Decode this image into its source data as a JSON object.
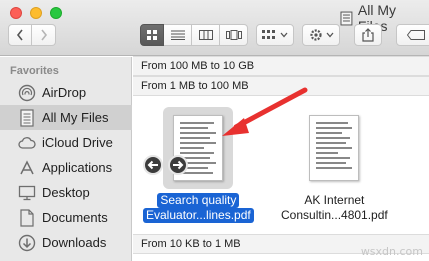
{
  "window": {
    "title": "All My Files"
  },
  "sidebar": {
    "header": "Favorites",
    "items": [
      {
        "label": "AirDrop",
        "icon": "airdrop-icon"
      },
      {
        "label": "All My Files",
        "icon": "all-my-files-icon",
        "selected": true
      },
      {
        "label": "iCloud Drive",
        "icon": "cloud-icon"
      },
      {
        "label": "Applications",
        "icon": "applications-icon"
      },
      {
        "label": "Desktop",
        "icon": "desktop-icon"
      },
      {
        "label": "Documents",
        "icon": "documents-icon"
      },
      {
        "label": "Downloads",
        "icon": "downloads-icon"
      }
    ]
  },
  "groups": {
    "g1": "From 100 MB to 10 GB",
    "g2": "From 1 MB to 100 MB",
    "g3": "From 10 KB to 1 MB"
  },
  "files": [
    {
      "line1": "Search quality",
      "line2": "Evaluator...lines.pdf",
      "selected": true
    },
    {
      "line1": "AK Internet",
      "line2": "Consultin...4801.pdf",
      "selected": false
    }
  ],
  "watermark": "wsxdn.com",
  "colors": {
    "selection": "#1a64d4",
    "annotation_arrow": "#e8312f"
  }
}
